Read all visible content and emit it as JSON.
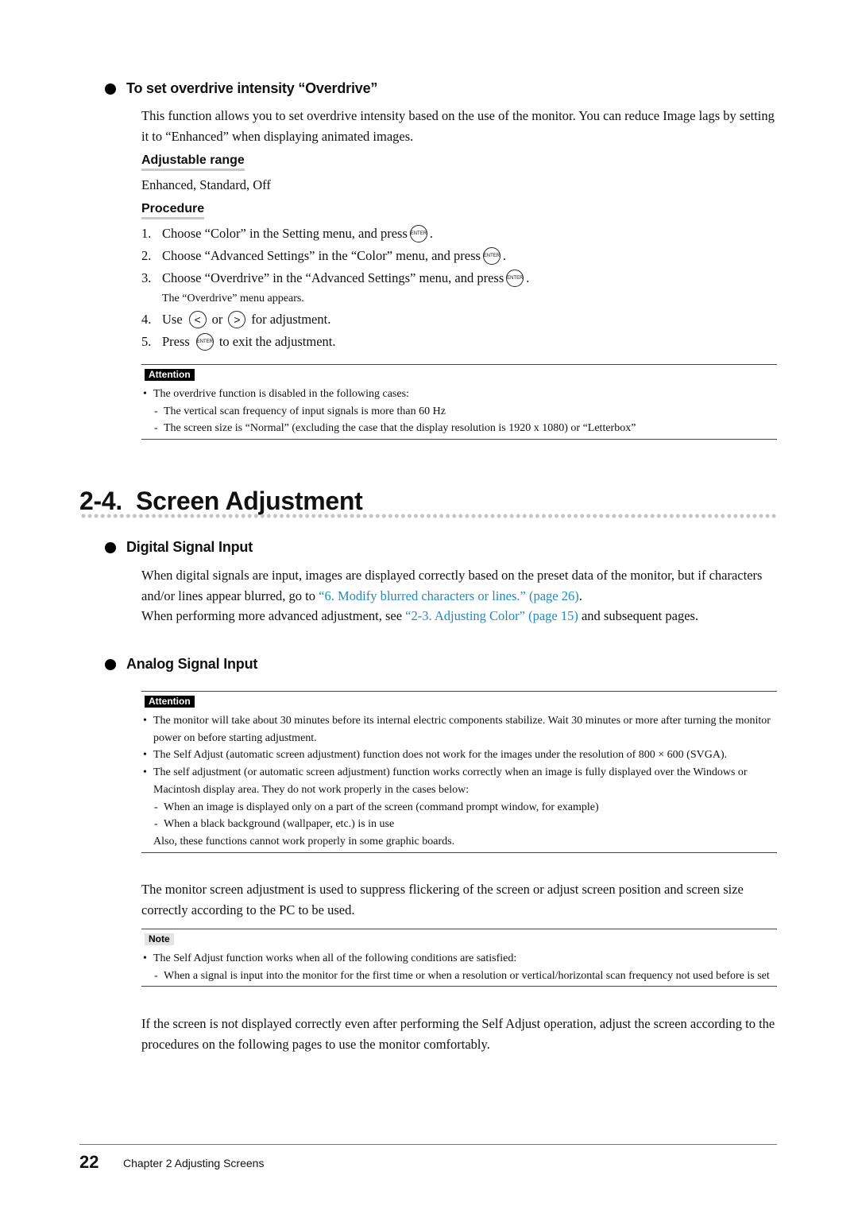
{
  "overdrive": {
    "heading": "To set overdrive intensity “Overdrive”",
    "description": "This function allows you to set overdrive intensity based on the use of the monitor. You can reduce Image lags by setting it to “Enhanced” when displaying animated images.",
    "range_heading": "Adjustable range",
    "range_value": "Enhanced, Standard, Off",
    "procedure_heading": "Procedure",
    "steps": [
      {
        "num": "1.",
        "text": "Choose “Color” in the Setting menu, and press",
        "suffix": "."
      },
      {
        "num": "2.",
        "text": "Choose “Advanced Settings” in the “Color” menu, and press",
        "suffix": "."
      },
      {
        "num": "3.",
        "text": "Choose “Overdrive” in the “Advanced Settings” menu, and press",
        "suffix": "."
      },
      {
        "note": "The “Overdrive” menu appears."
      },
      {
        "num": "4.",
        "text_before": "Use",
        "text_mid": "or",
        "text_after": "for adjustment."
      },
      {
        "num": "5.",
        "text_before": "Press",
        "text_after": "to exit the adjustment."
      }
    ],
    "button_labels": {
      "enter": "ENTER",
      "left": "<",
      "right": ">"
    },
    "attention": {
      "label": "Attention",
      "items": [
        {
          "type": "bullet",
          "text": "The overdrive function is disabled in the following cases:"
        },
        {
          "type": "dash",
          "text": "The vertical scan frequency of input signals is more than 60 Hz"
        },
        {
          "type": "dash",
          "text": "The screen size is “Normal” (excluding the case that the display resolution is 1920 x 1080) or “Letterbox”"
        }
      ]
    }
  },
  "section": {
    "title": "2-4.  Screen Adjustment"
  },
  "digital": {
    "heading": "Digital Signal Input",
    "p1_before": "When digital signals are input, images are displayed correctly based on the preset data of the monitor, but if characters and/or lines appear blurred, go to ",
    "p1_link": "“6. Modify blurred characters or lines.” (page 26)",
    "p1_after": ".",
    "p2_before": "When performing more advanced adjustment, see ",
    "p2_link": "“2-3. Adjusting Color” (page 15)",
    "p2_after": " and subsequent pages.",
    "link_color": "#1f8ac0"
  },
  "analog": {
    "heading": "Analog Signal Input",
    "attention": {
      "label": "Attention",
      "items": [
        {
          "type": "bullet",
          "text": "The monitor will take about 30 minutes before its internal electric components stabilize. Wait 30 minutes or more after turning the monitor power on before starting adjustment."
        },
        {
          "type": "bullet",
          "text": "The Self Adjust (automatic screen adjustment) function does not work for the images under the resolution of 800 × 600 (SVGA)."
        },
        {
          "type": "bullet",
          "text": "The self adjustment (or automatic screen adjustment) function works correctly when an image is fully displayed over the Windows or Macintosh display area. They do not work properly in the cases below:"
        },
        {
          "type": "dash",
          "text": "When an image is displayed only on a part of the screen (command prompt window, for example)"
        },
        {
          "type": "dash",
          "text": "When a black background (wallpaper, etc.) is in use"
        },
        {
          "type": "plain",
          "text": "Also, these functions cannot work properly in some graphic boards."
        }
      ]
    },
    "body1": "The monitor screen adjustment is used to suppress flickering of the screen or adjust screen position and screen size correctly according to the PC to be used.",
    "note": {
      "label": "Note",
      "items": [
        {
          "type": "bullet",
          "text": "The Self Adjust function works when all of the following conditions are satisfied:"
        },
        {
          "type": "dash",
          "text": "When a signal is input into the monitor for the first time or when a resolution or vertical/horizontal scan frequency not used before is set"
        }
      ]
    },
    "body2": "If the screen is not displayed correctly even after performing the Self Adjust operation, adjust the screen according to the procedures on the following pages to use the monitor comfortably."
  },
  "footer": {
    "page_number": "22",
    "chapter": "Chapter 2 Adjusting Screens"
  }
}
